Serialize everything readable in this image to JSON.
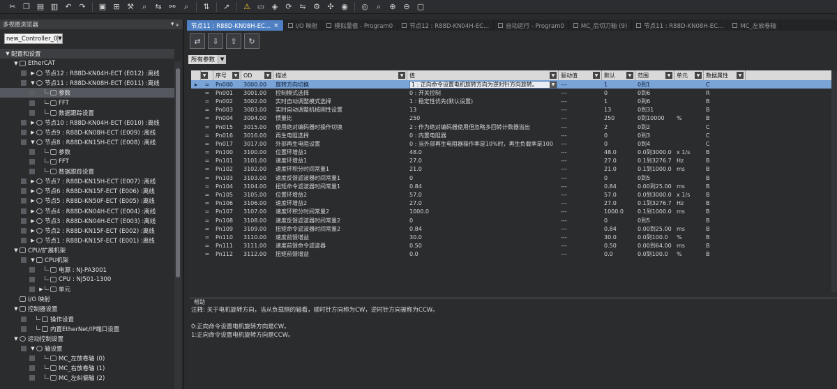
{
  "toolbar": {
    "icons": [
      "cut-icon",
      "copy-icon",
      "paste-icon",
      "delete-icon",
      "undo-icon",
      "redo-icon",
      "save-icon",
      "layout-icon",
      "tool-icon",
      "search-icon",
      "replace-icon",
      "binoculars-icon",
      "find-icon",
      "transfer-icon",
      "cursor-icon",
      "warning-icon",
      "monitor-icon",
      "online-icon",
      "sync-icon",
      "compare-icon",
      "settings-icon",
      "cross-ref-icon",
      "watch-icon",
      "trace-icon",
      "zoom-icon",
      "zoom-in-icon",
      "zoom-out-icon",
      "window-icon"
    ]
  },
  "left_panel": {
    "title": "多视图浏览器",
    "pin": "▾ ᵩ",
    "controller": "new_Controller_0",
    "tree": [
      {
        "label": "配置和设置",
        "exp": "▼",
        "indent": 0,
        "icon": "none",
        "root": true
      },
      {
        "label": "EtherCAT",
        "exp": "▼",
        "indent": 1,
        "icon": "ethercat"
      },
      {
        "label": "节点12 : R88D-KN04H-ECT (E012) :离线",
        "exp": "▶",
        "indent": 2,
        "icon": "gear"
      },
      {
        "label": "节点11 : R88D-KN08H-ECT (E011) :离线",
        "exp": "▼",
        "indent": 2,
        "icon": "gear"
      },
      {
        "label": "参数",
        "exp": "",
        "indent": 3,
        "icon": "leaf",
        "selected": true
      },
      {
        "label": "FFT",
        "exp": "",
        "indent": 3,
        "icon": "leaf"
      },
      {
        "label": "数据跟踪设置",
        "exp": "",
        "indent": 3,
        "icon": "leaf"
      },
      {
        "label": "节点10 : R88D-KN04H-ECT (E010) :离线",
        "exp": "▶",
        "indent": 2,
        "icon": "gear"
      },
      {
        "label": "节点9 : R88D-KN08H-ECT (E009) :离线",
        "exp": "▶",
        "indent": 2,
        "icon": "gear"
      },
      {
        "label": "节点8 : R88D-KN15H-ECT (E008) :离线",
        "exp": "▼",
        "indent": 2,
        "icon": "gear"
      },
      {
        "label": "参数",
        "exp": "",
        "indent": 3,
        "icon": "leaf"
      },
      {
        "label": "FFT",
        "exp": "",
        "indent": 3,
        "icon": "leaf"
      },
      {
        "label": "数据跟踪设置",
        "exp": "",
        "indent": 3,
        "icon": "leaf"
      },
      {
        "label": "节点7 : R88D-KN15H-ECT (E007) :离线",
        "exp": "▶",
        "indent": 2,
        "icon": "gear"
      },
      {
        "label": "节点6 : R88D-KN15F-ECT (E006) :离线",
        "exp": "▶",
        "indent": 2,
        "icon": "gear"
      },
      {
        "label": "节点5 : R88D-KN50F-ECT (E005) :离线",
        "exp": "▶",
        "indent": 2,
        "icon": "gear"
      },
      {
        "label": "节点4 : R88D-KN04H-ECT (E004) :离线",
        "exp": "▶",
        "indent": 2,
        "icon": "gear"
      },
      {
        "label": "节点3 : R88D-KN04H-ECT (E003) :离线",
        "exp": "▶",
        "indent": 2,
        "icon": "gear"
      },
      {
        "label": "节点2 : R88D-KN15F-ECT (E002) :离线",
        "exp": "▶",
        "indent": 2,
        "icon": "gear"
      },
      {
        "label": "节点1 : R88D-KN15F-ECT (E001) :离线",
        "exp": "▶",
        "indent": 2,
        "icon": "gear"
      },
      {
        "label": "CPU/扩展机架",
        "exp": "▼",
        "indent": 1,
        "icon": "rack"
      },
      {
        "label": "CPU机架",
        "exp": "▼",
        "indent": 2,
        "icon": "rack"
      },
      {
        "label": "电源 : NJ-PA3001",
        "exp": "",
        "indent": 3,
        "icon": "leaf"
      },
      {
        "label": "CPU : NJ501-1300",
        "exp": "",
        "indent": 3,
        "icon": "leaf"
      },
      {
        "label": "单元",
        "exp": "▶",
        "indent": 3,
        "icon": "leaf"
      },
      {
        "label": "I/O 映射",
        "exp": "",
        "indent": 1,
        "icon": "io"
      },
      {
        "label": "控制器设置",
        "exp": "▼",
        "indent": 1,
        "icon": "ctrl"
      },
      {
        "label": "操作设置",
        "exp": "",
        "indent": 2,
        "icon": "leaf"
      },
      {
        "label": "内置EtherNet/IP端口设置",
        "exp": "",
        "indent": 2,
        "icon": "leaf"
      },
      {
        "label": "运动控制设置",
        "exp": "▼",
        "indent": 1,
        "icon": "gear"
      },
      {
        "label": "轴设置",
        "exp": "▼",
        "indent": 2,
        "icon": "gear"
      },
      {
        "label": "MC_左放卷轴 (0)",
        "exp": "",
        "indent": 3,
        "icon": "leaf"
      },
      {
        "label": "MC_右放卷轴 (1)",
        "exp": "",
        "indent": 3,
        "icon": "leaf"
      },
      {
        "label": "MC_左纠偏轴 (2)",
        "exp": "",
        "indent": 3,
        "icon": "leaf"
      }
    ]
  },
  "tabs": [
    {
      "label": "节点11 : R88D-KN08H-EC...",
      "active": true,
      "closable": true
    },
    {
      "label": "I/O 映射",
      "active": false
    },
    {
      "label": "模拟量值 - Program0",
      "active": false
    },
    {
      "label": "节点12 : R88D-KN04H-EC...",
      "active": false
    },
    {
      "label": "自动运行 - Program0",
      "active": false
    },
    {
      "label": "MC_后切刀轴 (9)",
      "active": false
    },
    {
      "label": "节点11 : R88D-KN08H-EC...",
      "active": false
    },
    {
      "label": "MC_左放卷轴",
      "active": false
    }
  ],
  "filter": {
    "label": "所有参数"
  },
  "table": {
    "headers": [
      "序号",
      "OD",
      "描述",
      "值",
      "驱动值",
      "默认",
      "范围",
      "单元",
      "数据属性"
    ],
    "rows": [
      {
        "no": "Pn000",
        "od": "3000.00",
        "desc": "旋转方向切换",
        "val": "1 : 正向命令设置电机旋转方向为逆时针方向旋转。",
        "drv": "---",
        "def": "1",
        "rng": "0到1",
        "unit": "",
        "attr": "C",
        "selected": true
      },
      {
        "no": "Pn001",
        "od": "3001.00",
        "desc": "控制模式选择",
        "val": "0 : 开关控制",
        "drv": "---",
        "def": "0",
        "rng": "0到6",
        "unit": "",
        "attr": "R"
      },
      {
        "no": "Pn002",
        "od": "3002.00",
        "desc": "实时自动调整模式选择",
        "val": "1 : 稳定性优先(默认设置)",
        "drv": "---",
        "def": "1",
        "rng": "0到6",
        "unit": "",
        "attr": "B"
      },
      {
        "no": "Pn003",
        "od": "3003.00",
        "desc": "实时自动调整机械刚性设置",
        "val": "13",
        "drv": "---",
        "def": "13",
        "rng": "0到31",
        "unit": "",
        "attr": "B"
      },
      {
        "no": "Pn004",
        "od": "3004.00",
        "desc": "惯量比",
        "val": "250",
        "drv": "---",
        "def": "250",
        "rng": "0到10000",
        "unit": "%",
        "attr": "B"
      },
      {
        "no": "Pn015",
        "od": "3015.00",
        "desc": "使用绝对编码器时操作切换",
        "val": "2 : 作为绝对编码器使用但忽略多回转计数器溢出",
        "drv": "---",
        "def": "2",
        "rng": "0到2",
        "unit": "",
        "attr": "C"
      },
      {
        "no": "Pn016",
        "od": "3016.00",
        "desc": "再生电阻选择",
        "val": "0 : 内置电阻器",
        "drv": "---",
        "def": "0",
        "rng": "0到3",
        "unit": "",
        "attr": "C"
      },
      {
        "no": "Pn017",
        "od": "3017.00",
        "desc": "外部再生电阻设置",
        "val": "0 : 当外部再生电阻器操作率是10%时，再生负载率是100",
        "drv": "---",
        "def": "0",
        "rng": "0到4",
        "unit": "",
        "attr": "C"
      },
      {
        "no": "Pn100",
        "od": "3100.00",
        "desc": "位置环增益1",
        "val": "48.0",
        "drv": "---",
        "def": "48.0",
        "rng": "0.0到3000.0",
        "unit": "x 1/s",
        "attr": "B"
      },
      {
        "no": "Pn101",
        "od": "3101.00",
        "desc": "速度环增益1",
        "val": "27.0",
        "drv": "---",
        "def": "27.0",
        "rng": "0.1到3276.7",
        "unit": "Hz",
        "attr": "B"
      },
      {
        "no": "Pn102",
        "od": "3102.00",
        "desc": "速度环积分时间常量1",
        "val": "21.0",
        "drv": "---",
        "def": "21.0",
        "rng": "0.1到1000.0",
        "unit": "ms",
        "attr": "B"
      },
      {
        "no": "Pn103",
        "od": "3103.00",
        "desc": "速度反馈滤波器时间常量1",
        "val": "0",
        "drv": "---",
        "def": "0",
        "rng": "0到5",
        "unit": "",
        "attr": "B"
      },
      {
        "no": "Pn104",
        "od": "3104.00",
        "desc": "扭矩命令滤波器时间常量1",
        "val": "0.84",
        "drv": "---",
        "def": "0.84",
        "rng": "0.00到25.00",
        "unit": "ms",
        "attr": "B"
      },
      {
        "no": "Pn105",
        "od": "3105.00",
        "desc": "位置环增益2",
        "val": "57.0",
        "drv": "---",
        "def": "57.0",
        "rng": "0.0到3000.0",
        "unit": "x 1/s",
        "attr": "B"
      },
      {
        "no": "Pn106",
        "od": "3106.00",
        "desc": "速度环增益2",
        "val": "27.0",
        "drv": "---",
        "def": "27.0",
        "rng": "0.1到3276.7",
        "unit": "Hz",
        "attr": "B"
      },
      {
        "no": "Pn107",
        "od": "3107.00",
        "desc": "速度环积分时间常量2",
        "val": "1000.0",
        "drv": "---",
        "def": "1000.0",
        "rng": "0.1到1000.0",
        "unit": "ms",
        "attr": "B"
      },
      {
        "no": "Pn108",
        "od": "3108.00",
        "desc": "速度反馈滤波器时间常量2",
        "val": "0",
        "drv": "---",
        "def": "0",
        "rng": "0到5",
        "unit": "",
        "attr": "B"
      },
      {
        "no": "Pn109",
        "od": "3109.00",
        "desc": "扭矩命令滤波器时间常量2",
        "val": "0.84",
        "drv": "---",
        "def": "0.84",
        "rng": "0.00到25.00",
        "unit": "ms",
        "attr": "B"
      },
      {
        "no": "Pn110",
        "od": "3110.00",
        "desc": "速度前馈增益",
        "val": "30.0",
        "drv": "---",
        "def": "30.0",
        "rng": "0.0到100.0",
        "unit": "%",
        "attr": "B"
      },
      {
        "no": "Pn111",
        "od": "3111.00",
        "desc": "速度前馈命令滤波器",
        "val": "0.50",
        "drv": "---",
        "def": "0.50",
        "rng": "0.00到64.00",
        "unit": "ms",
        "attr": "B"
      },
      {
        "no": "Pn112",
        "od": "3112.00",
        "desc": "扭矩前馈增益",
        "val": "0.0",
        "drv": "---",
        "def": "0.0",
        "rng": "0.0到100.0",
        "unit": "%",
        "attr": "B"
      }
    ]
  },
  "help": {
    "title": "帮助",
    "lines": [
      "注释: 关于电机旋转方向，当从负载侧的轴看，顺时针方向称为CW，逆时针方向被称为CCW。",
      "",
      "0:正向命令设置电机旋转方向是CW。",
      "1:正向命令设置电机旋转方向是CCW。"
    ]
  },
  "colors": {
    "active_tab": "#4f80c4",
    "selected_row": "#7aa3d6",
    "warning": "#e8c22a"
  }
}
